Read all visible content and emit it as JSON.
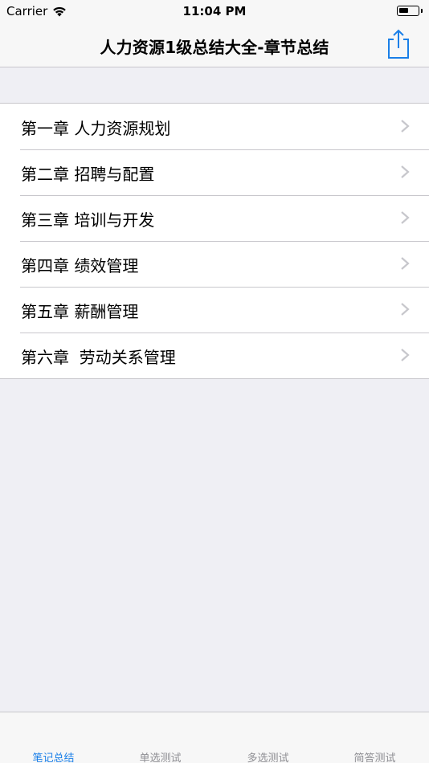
{
  "status_bar": {
    "carrier": "Carrier",
    "time": "11:04 PM"
  },
  "nav": {
    "title": "人力资源1级总结大全-章节总结",
    "share_icon": "share-icon"
  },
  "chapters": [
    {
      "label": "第一章 人力资源规划"
    },
    {
      "label": "第二章 招聘与配置"
    },
    {
      "label": "第三章 培训与开发"
    },
    {
      "label": "第四章 绩效管理"
    },
    {
      "label": "第五章 薪酬管理"
    },
    {
      "label": "第六章  劳动关系管理"
    }
  ],
  "tabs": [
    {
      "label": "笔记总结",
      "active": true
    },
    {
      "label": "单选测试",
      "active": false
    },
    {
      "label": "多选测试",
      "active": false
    },
    {
      "label": "简答测试",
      "active": false
    }
  ],
  "colors": {
    "accent": "#1a7fe8",
    "background": "#efeff4",
    "separator": "#c8c7cc",
    "chevron": "#c7c7cc",
    "inactive_tab": "#8e8e93"
  }
}
